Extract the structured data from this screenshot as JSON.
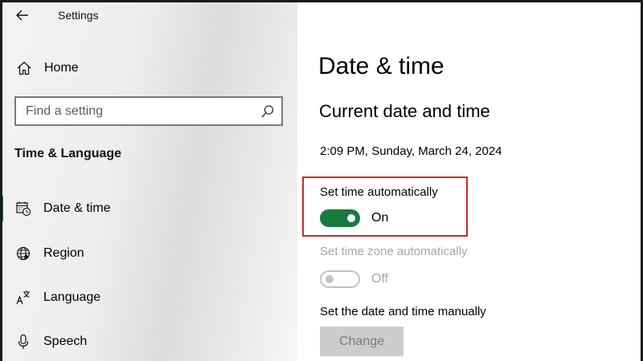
{
  "window": {
    "title": "Settings"
  },
  "sidebar": {
    "home_label": "Home",
    "search_placeholder": "Find a setting",
    "section_title": "Time & Language",
    "items": [
      {
        "label": "Date & time",
        "icon": "calendar-clock-icon",
        "active": true
      },
      {
        "label": "Region",
        "icon": "globe-icon",
        "active": false
      },
      {
        "label": "Language",
        "icon": "language-icon",
        "active": false
      },
      {
        "label": "Speech",
        "icon": "microphone-icon",
        "active": false
      }
    ]
  },
  "main": {
    "page_title": "Date & time",
    "subtitle": "Current date and time",
    "current_datetime": "2:09 PM, Sunday, March 24, 2024",
    "set_time_auto": {
      "label": "Set time automatically",
      "state": "On",
      "enabled": true
    },
    "set_timezone_auto": {
      "label": "Set time zone automatically",
      "state": "Off",
      "enabled": false
    },
    "manual_label": "Set the date and time manually",
    "change_button": "Change"
  },
  "colors": {
    "accent": "#1a7a3c",
    "highlight_border": "#c8262b",
    "disabled_text": "#a7a7a7"
  }
}
